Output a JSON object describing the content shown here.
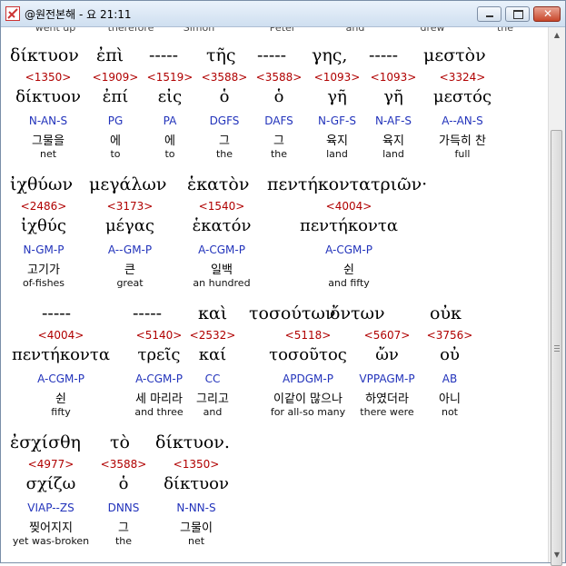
{
  "window": {
    "title": "@원전본해 - 요 21:11"
  },
  "top_row": [
    "went up",
    "therefore",
    "Simon",
    "Peter",
    "and",
    "drew",
    "the"
  ],
  "lines": [
    {
      "greek": [
        "δίκτυον",
        "ἐπὶ",
        "-----",
        "τῆς",
        "-----",
        "γης,",
        "-----",
        "μεστὸν"
      ],
      "words": [
        {
          "num": "<1350>",
          "lemma": "δίκτυον",
          "parse": "N-AN-S",
          "kor": "그물을",
          "eng": "net"
        },
        {
          "num": "<1909>",
          "lemma": "ἐπί",
          "parse": "PG",
          "kor": "에",
          "eng": "to"
        },
        {
          "num": "<1519>",
          "lemma": "εἰς",
          "parse": "PA",
          "kor": "에",
          "eng": "to"
        },
        {
          "num": "<3588>",
          "lemma": "ὁ",
          "parse": "DGFS",
          "kor": "그",
          "eng": "the"
        },
        {
          "num": "<3588>",
          "lemma": "ὁ",
          "parse": "DAFS",
          "kor": "그",
          "eng": "the"
        },
        {
          "num": "<1093>",
          "lemma": "γῆ",
          "parse": "N-GF-S",
          "kor": "육지",
          "eng": "land"
        },
        {
          "num": "<1093>",
          "lemma": "γῆ",
          "parse": "N-AF-S",
          "kor": "육지",
          "eng": "land"
        },
        {
          "num": "<3324>",
          "lemma": "μεστός",
          "parse": "A--AN-S",
          "kor": "가득히 찬",
          "eng": "full"
        }
      ]
    },
    {
      "greek": [
        "ἰχθύων",
        "μεγάλων",
        "ἑκατὸν",
        "πεντήκοντατριῶν·"
      ],
      "words": [
        {
          "num": "<2486>",
          "lemma": "ἰχθύς",
          "parse": "N-GM-P",
          "kor": "고기가",
          "eng": "of-fishes"
        },
        {
          "num": "<3173>",
          "lemma": "μέγας",
          "parse": "A--GM-P",
          "kor": "큰",
          "eng": "great"
        },
        {
          "num": "<1540>",
          "lemma": "ἑκατόν",
          "parse": "A-CGM-P",
          "kor": "일백",
          "eng": "an hundred"
        },
        {
          "num": "<4004>",
          "lemma": "πεντήκοντα",
          "parse": "A-CGM-P",
          "kor": "쉰",
          "eng": "and fifty"
        }
      ]
    },
    {
      "greek": [
        "-----",
        "-----",
        "καὶ",
        "τοσούτων",
        "ὄντων",
        "οὐκ"
      ],
      "words": [
        {
          "num": "<4004>",
          "lemma": "πεντήκοντα",
          "parse": "A-CGM-P",
          "kor": "쉰",
          "eng": "fifty"
        },
        {
          "num": "<5140>",
          "lemma": "τρεῖς",
          "parse": "A-CGM-P",
          "kor": "세 마리라",
          "eng": "and three"
        },
        {
          "num": "<2532>",
          "lemma": "καί",
          "parse": "CC",
          "kor": "그리고",
          "eng": "and"
        },
        {
          "num": "<5118>",
          "lemma": "τοσοῦτος",
          "parse": "APDGM-P",
          "kor": "이같이 많으나",
          "eng": "for all-so many"
        },
        {
          "num": "<5607>",
          "lemma": "ὤν",
          "parse": "VPPAGM-P",
          "kor": "하였더라",
          "eng": "there were"
        },
        {
          "num": "<3756>",
          "lemma": "οὐ",
          "parse": "AB",
          "kor": "아니",
          "eng": "not"
        }
      ]
    },
    {
      "greek": [
        "ἐσχίσθη",
        "τὸ",
        "δίκτυον."
      ],
      "words": [
        {
          "num": "<4977>",
          "lemma": "σχίζω",
          "parse": "VIAP--ZS",
          "kor": "찢어지지",
          "eng": "yet was-broken"
        },
        {
          "num": "<3588>",
          "lemma": "ὁ",
          "parse": "DNNS",
          "kor": "그",
          "eng": "the"
        },
        {
          "num": "<1350>",
          "lemma": "δίκτυον",
          "parse": "N-NN-S",
          "kor": "그물이",
          "eng": "net"
        }
      ]
    }
  ]
}
